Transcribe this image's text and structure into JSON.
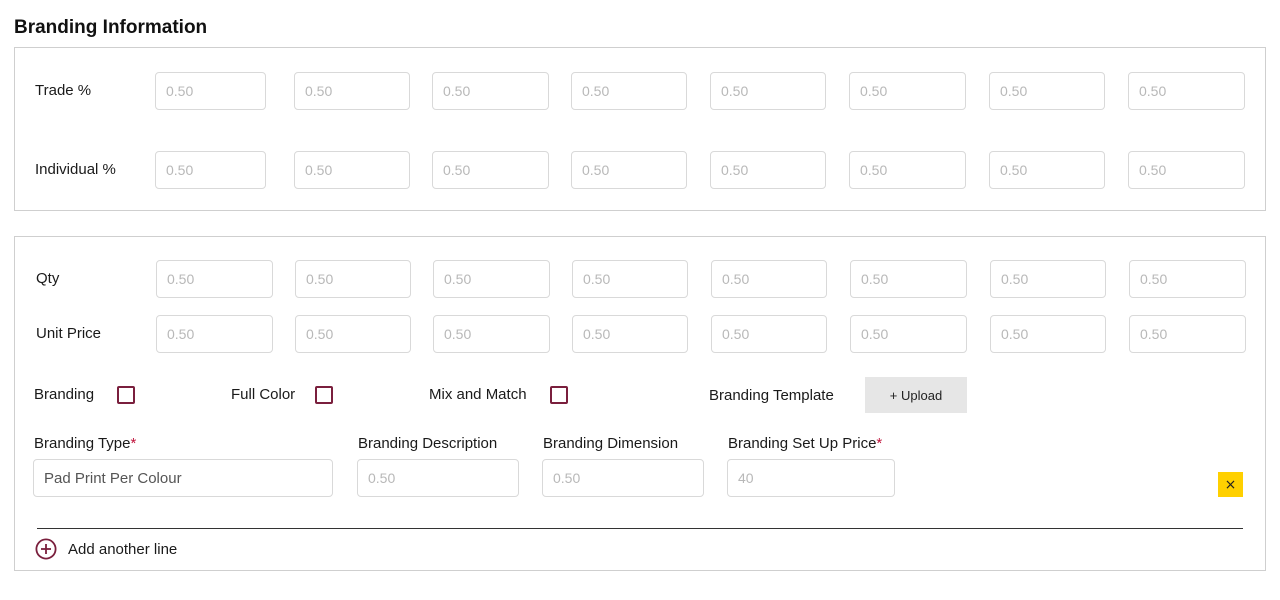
{
  "page": {
    "title": "Branding Information"
  },
  "margins": {
    "trade_label": "Trade %",
    "trade_values": [
      "0.50",
      "0.50",
      "0.50",
      "0.50",
      "0.50",
      "0.50",
      "0.50",
      "0.50"
    ],
    "individual_label": "Individual %",
    "individual_values": [
      "0.50",
      "0.50",
      "0.50",
      "0.50",
      "0.50",
      "0.50",
      "0.50",
      "0.50"
    ]
  },
  "pricing": {
    "qty_label": "Qty",
    "qty_values": [
      "0.50",
      "0.50",
      "0.50",
      "0.50",
      "0.50",
      "0.50",
      "0.50",
      "0.50"
    ],
    "unit_price_label": "Unit Price",
    "unit_price_values": [
      "0.50",
      "0.50",
      "0.50",
      "0.50",
      "0.50",
      "0.50",
      "0.50",
      "0.50"
    ]
  },
  "options": {
    "branding_label": "Branding",
    "branding_checked": false,
    "full_color_label": "Full Color",
    "full_color_checked": false,
    "mix_match_label": "Mix and Match",
    "mix_match_checked": false,
    "template_label": "Branding Template",
    "upload_label": "+ Upload"
  },
  "branding_line": {
    "type_label": "Branding Type",
    "type_value": "Pad Print Per Colour",
    "description_label": "Branding Description",
    "description_placeholder": "0.50",
    "dimension_label": "Branding Dimension",
    "dimension_placeholder": "0.50",
    "setup_price_label": "Branding Set Up Price",
    "setup_price_placeholder": "40",
    "required_mark": "*",
    "delete_label": "×"
  },
  "add_line": {
    "label": "Add another line"
  },
  "colors": {
    "accent": "#7a1f3d",
    "delete": "#ffd000",
    "border": "#cfcfcf"
  }
}
